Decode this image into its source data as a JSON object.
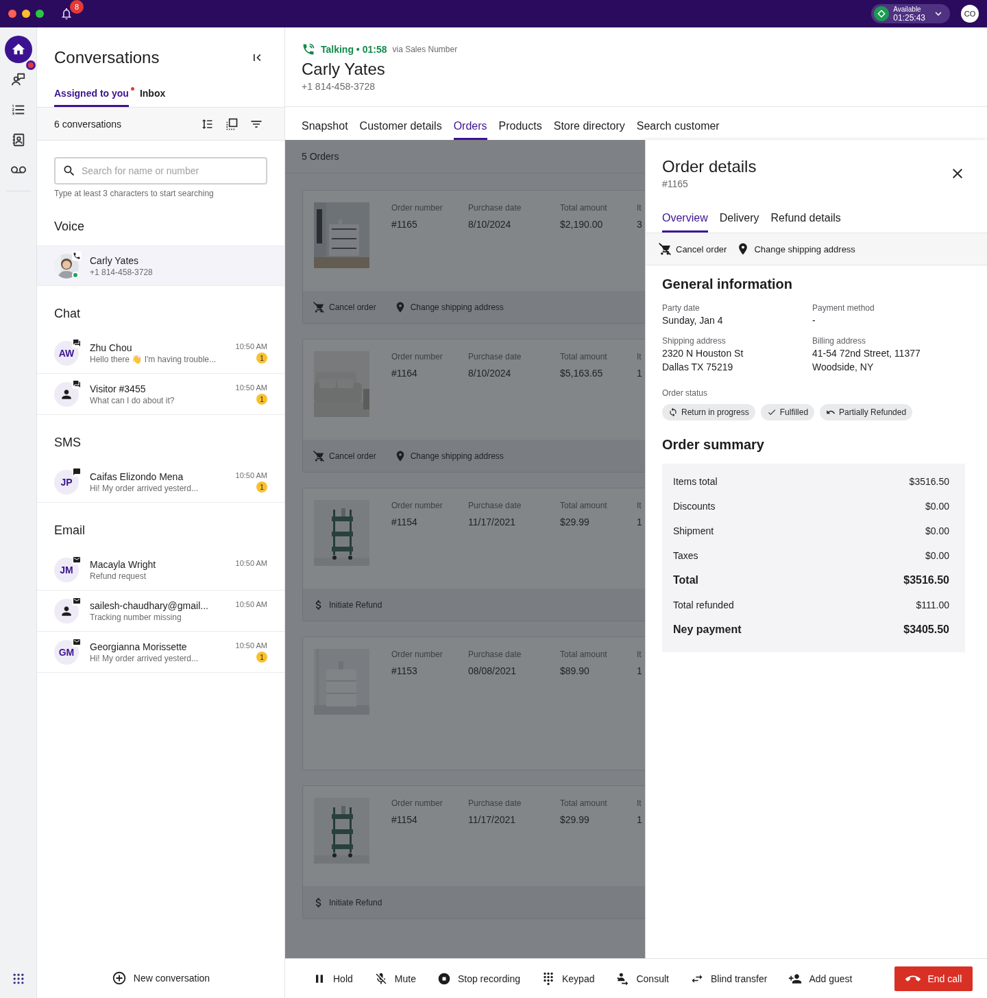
{
  "top_bar": {
    "notifications": "8",
    "status": {
      "label": "Available",
      "timer": "01:25:43"
    },
    "avatar": "CO"
  },
  "nav_rail": {
    "items": [
      {
        "kind": "home",
        "selected": true,
        "badge": false
      },
      {
        "kind": "agents",
        "selected": false,
        "badge": true
      },
      {
        "kind": "list",
        "selected": false,
        "badge": false
      },
      {
        "kind": "contacts",
        "selected": false,
        "badge": false
      },
      {
        "kind": "voicemail",
        "selected": false,
        "badge": false
      }
    ]
  },
  "conversations": {
    "title": "Conversations",
    "tabs": [
      {
        "label": "Assigned to you",
        "selected": true,
        "dot": true
      },
      {
        "label": "Inbox",
        "selected": false,
        "dot": false
      }
    ],
    "count": "6 conversations",
    "search": {
      "placeholder": "Search for name or number",
      "hint": "Type at least 3 characters to start searching"
    },
    "sections": [
      {
        "title": "Voice",
        "kind": "voice",
        "items": [
          {
            "name": "Carly Yates",
            "preview": "+1 814-458-3728",
            "online": true,
            "selected": true
          }
        ]
      },
      {
        "title": "Chat",
        "kind": "chat",
        "items": [
          {
            "name": "Zhu Chou",
            "preview": "Hello there 👋 I'm having trouble...",
            "avatar": {
              "kind": "initials",
              "initials": "AW"
            },
            "time": "10:50 AM",
            "unread": "1",
            "online": false,
            "selected": false
          },
          {
            "name": "Visitor #3455",
            "preview": "What can I do about it?",
            "avatar": {
              "kind": "person"
            },
            "time": "10:50 AM",
            "unread": "1",
            "online": false,
            "selected": false
          }
        ]
      },
      {
        "title": "SMS",
        "kind": "sms",
        "items": [
          {
            "name": "Caifas Elizondo Mena",
            "preview": "Hi! My order arrived yesterd...",
            "avatar": {
              "kind": "initials",
              "initials": "JP"
            },
            "time": "10:50 AM",
            "unread": "1",
            "online": false,
            "selected": false
          }
        ]
      },
      {
        "title": "Email",
        "kind": "email",
        "items": [
          {
            "name": "Macayla Wright",
            "preview": "Refund request",
            "avatar": {
              "kind": "initials",
              "initials": "JM"
            },
            "time": "10:50 AM",
            "online": false,
            "selected": false
          },
          {
            "name": "sailesh-chaudhary@gmail...",
            "preview": "Tracking number missing",
            "avatar": {
              "kind": "person"
            },
            "time": "10:50 AM",
            "online": false,
            "selected": false
          },
          {
            "name": "Georgianna Morissette",
            "preview": "Hi! My order arrived yesterd...",
            "avatar": {
              "kind": "initials",
              "initials": "GM"
            },
            "time": "10:50 AM",
            "unread": "1",
            "online": false,
            "selected": false
          }
        ]
      }
    ],
    "new_button": "New conversation"
  },
  "call_header": {
    "status": "Talking • 01:58",
    "via": "via Sales Number",
    "name": "Carly Yates",
    "phone": "+1 814-458-3728"
  },
  "tabs": [
    {
      "label": "Snapshot",
      "selected": false
    },
    {
      "label": "Customer details",
      "selected": false
    },
    {
      "label": "Orders",
      "selected": true
    },
    {
      "label": "Products",
      "selected": false
    },
    {
      "label": "Store directory",
      "selected": false
    },
    {
      "label": "Search customer",
      "selected": false
    }
  ],
  "orders": {
    "count": "5 Orders",
    "items": [
      {
        "fields": [
          {
            "label": "Order number",
            "value": "#1165"
          },
          {
            "label": "Purchase date",
            "value": "8/10/2024"
          },
          {
            "label": "Total amount",
            "value": "$2,190.00"
          },
          {
            "label": "It",
            "value": "3"
          }
        ],
        "actions": [
          {
            "kind": "cancel",
            "label": "Cancel order"
          },
          {
            "kind": "address",
            "label": "Change shipping address"
          }
        ]
      },
      {
        "fields": [
          {
            "label": "Order number",
            "value": "#1164"
          },
          {
            "label": "Purchase date",
            "value": "8/10/2024"
          },
          {
            "label": "Total amount",
            "value": "$5,163.65"
          },
          {
            "label": "It",
            "value": "1"
          }
        ],
        "actions": [
          {
            "kind": "cancel",
            "label": "Cancel order"
          },
          {
            "kind": "address",
            "label": "Change shipping address"
          }
        ]
      },
      {
        "fields": [
          {
            "label": "Order number",
            "value": "#1154"
          },
          {
            "label": "Purchase date",
            "value": "11/17/2021"
          },
          {
            "label": "Total amount",
            "value": "$29.99"
          },
          {
            "label": "It",
            "value": "1"
          }
        ],
        "actions": [
          {
            "kind": "refund",
            "label": "Initiate Refund"
          }
        ]
      },
      {
        "fields": [
          {
            "label": "Order number",
            "value": "#1153"
          },
          {
            "label": "Purchase date",
            "value": "08/08/2021"
          },
          {
            "label": "Total amount",
            "value": "$89.90"
          },
          {
            "label": "It",
            "value": "1"
          }
        ]
      },
      {
        "fields": [
          {
            "label": "Order number",
            "value": "#1154"
          },
          {
            "label": "Purchase date",
            "value": "11/17/2021"
          },
          {
            "label": "Total amount",
            "value": "$29.99"
          },
          {
            "label": "It",
            "value": "1"
          }
        ],
        "actions": [
          {
            "kind": "refund",
            "label": "Initiate Refund"
          }
        ]
      }
    ]
  },
  "order_details": {
    "title": "Order details",
    "number": "#1165",
    "tabs": [
      {
        "label": "Overview",
        "selected": true
      },
      {
        "label": "Delivery",
        "selected": false
      },
      {
        "label": "Refund details",
        "selected": false
      }
    ],
    "actions": [
      {
        "kind": "cancel",
        "label": "Cancel order"
      },
      {
        "kind": "address",
        "label": "Change shipping address"
      }
    ],
    "general": {
      "title": "General information",
      "fields": [
        {
          "label": "Party date",
          "lines": [
            "Sunday, Jan 4"
          ]
        },
        {
          "label": "Payment method",
          "lines": [
            "-"
          ]
        },
        {
          "label": "Shipping address",
          "lines": [
            "2320 N Houston St",
            "Dallas TX 75219"
          ]
        },
        {
          "label": "Billing address",
          "lines": [
            "41-54 72nd Street, 11377",
            "Woodside, NY"
          ]
        }
      ],
      "status_label": "Order status",
      "statuses": [
        {
          "kind": "return",
          "label": "Return in progress"
        },
        {
          "kind": "check",
          "label": "Fulfilled"
        },
        {
          "kind": "refund",
          "label": "Partially Refunded"
        }
      ]
    },
    "summary": {
      "title": "Order summary",
      "rows": [
        {
          "label": "Items total",
          "value": "$3516.50",
          "kind": "normal"
        },
        {
          "label": "Discounts",
          "value": "$0.00",
          "kind": "normal"
        },
        {
          "label": "Shipment",
          "value": "$0.00",
          "kind": "normal"
        },
        {
          "label": "Taxes",
          "value": "$0.00",
          "kind": "normal"
        },
        {
          "label": "Total",
          "value": "$3516.50",
          "kind": "total"
        },
        {
          "label": "Total refunded",
          "value": "$111.00",
          "kind": "normal"
        },
        {
          "label": "Ney payment",
          "value": "$3405.50",
          "kind": "total"
        }
      ]
    }
  },
  "call_bar": {
    "actions": [
      {
        "kind": "hold",
        "label": "Hold"
      },
      {
        "kind": "mute",
        "label": "Mute"
      },
      {
        "kind": "stop_recording",
        "label": "Stop recording"
      },
      {
        "kind": "keypad",
        "label": "Keypad"
      },
      {
        "kind": "consult",
        "label": "Consult"
      },
      {
        "kind": "transfer",
        "label": "Blind transfer"
      },
      {
        "kind": "add_guest",
        "label": "Add guest"
      }
    ],
    "end": {
      "label": "End call"
    }
  }
}
